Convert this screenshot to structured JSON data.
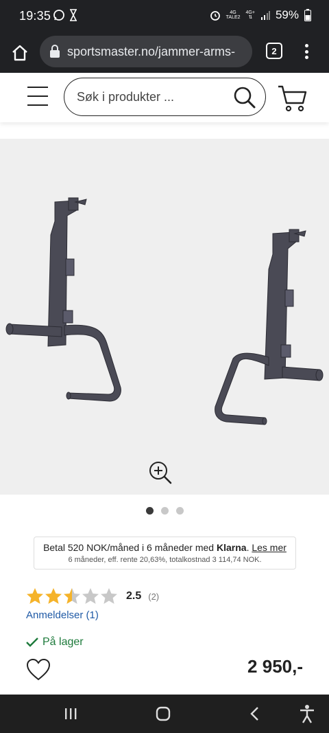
{
  "status_bar": {
    "time": "19:35",
    "battery": "59%",
    "network_1": "4G",
    "network_1_sub": "TALE2",
    "network_2": "4G+"
  },
  "browser": {
    "url": "sportsmaster.no/jammer-arms-",
    "tab_count": "2"
  },
  "header": {
    "search_placeholder": "Søk i produkter ..."
  },
  "gallery": {
    "total_images": 3,
    "active_index": 0
  },
  "klarna": {
    "prefix": "Betal 520 NOK/måned i 6 måneder med ",
    "brand": "Klarna",
    "suffix": ".",
    "link": "Les mer",
    "details": "6 måneder, eff. rente 20,63%, totalkostnad 3 114,74 NOK."
  },
  "product": {
    "rating_value": 2.5,
    "rating_text": "2.5",
    "rating_count": "(2)",
    "reviews_link": "Anmeldelser (1)",
    "stock_status": "På lager",
    "price": "2 950,-"
  },
  "colors": {
    "accent_green": "#1d7a3b",
    "link_blue": "#1f5aa6",
    "star_filled": "#f5b32a",
    "star_empty": "#c8c8c8"
  },
  "icons": [
    "home-icon",
    "lock-icon",
    "tabs-icon",
    "menu-icon",
    "hamburger-icon",
    "search-icon",
    "cart-icon",
    "zoom-in-icon",
    "star-icon",
    "check-icon",
    "heart-icon"
  ]
}
